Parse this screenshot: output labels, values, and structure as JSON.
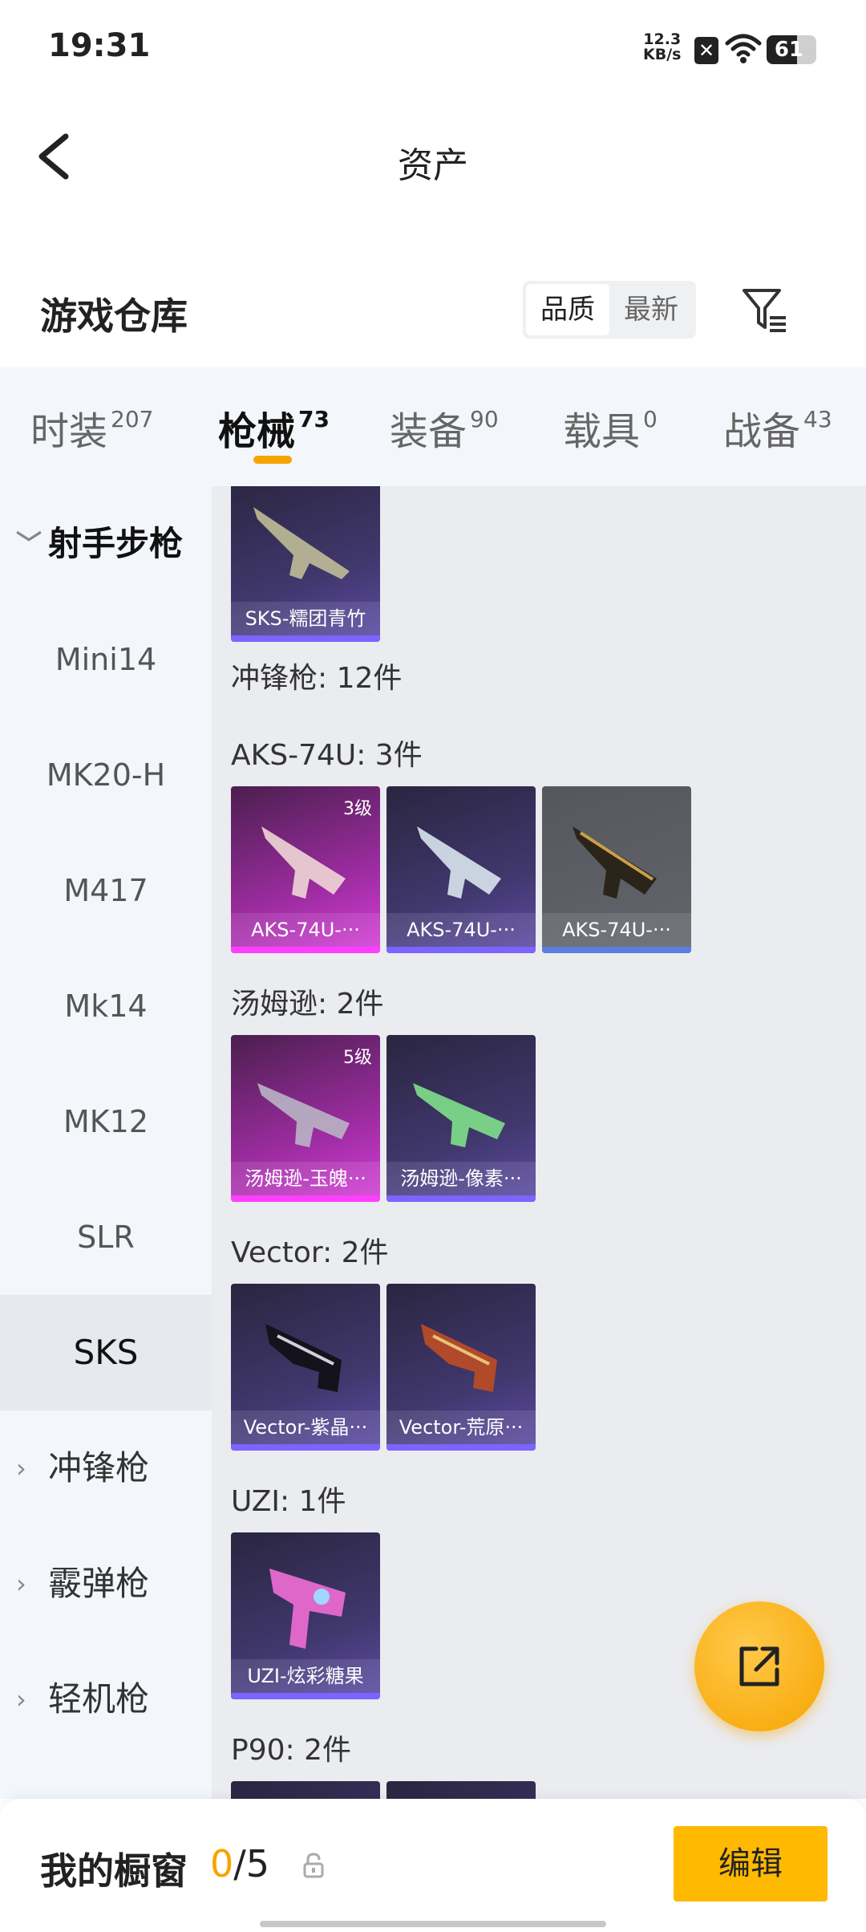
{
  "status_bar": {
    "time": "19:31",
    "net_speed": "12.3",
    "net_unit": "KB/s",
    "battery": "61"
  },
  "header": {
    "title": "资产"
  },
  "warehouse": {
    "title": "游戏仓库",
    "sort_options": [
      "品质",
      "最新"
    ],
    "active_sort": "品质"
  },
  "tabs": [
    {
      "label": "时装",
      "count": "207"
    },
    {
      "label": "枪械",
      "count": "73"
    },
    {
      "label": "装备",
      "count": "90"
    },
    {
      "label": "载具",
      "count": "0"
    },
    {
      "label": "战备",
      "count": "43"
    }
  ],
  "sidebar": {
    "group_open": "射手步枪",
    "items": [
      "Mini14",
      "MK20-H",
      "M417",
      "Mk14",
      "MK12",
      "SLR",
      "SKS"
    ],
    "active_item": "SKS",
    "collapsed_groups": [
      "冲锋枪",
      "霰弹枪",
      "轻机枪"
    ]
  },
  "content": {
    "top_card": {
      "name": "SKS-糯团青竹",
      "rarity": "purple"
    },
    "category_heading": "冲锋枪: 12件",
    "sections": [
      {
        "title": "AKS-74U: 3件",
        "cards": [
          {
            "name": "AKS-74U-···",
            "rarity": "pink",
            "level": "3级"
          },
          {
            "name": "AKS-74U-···",
            "rarity": "purple"
          },
          {
            "name": "AKS-74U-···",
            "rarity": "grey"
          }
        ]
      },
      {
        "title": "汤姆逊: 2件",
        "cards": [
          {
            "name": "汤姆逊-玉魄···",
            "rarity": "pink",
            "level": "5级"
          },
          {
            "name": "汤姆逊-像素···",
            "rarity": "purple"
          }
        ]
      },
      {
        "title": "Vector: 2件",
        "cards": [
          {
            "name": "Vector-紫晶···",
            "rarity": "purple"
          },
          {
            "name": "Vector-荒原···",
            "rarity": "purple"
          }
        ]
      },
      {
        "title": "UZI: 1件",
        "cards": [
          {
            "name": "UZI-炫彩糖果",
            "rarity": "purple"
          }
        ]
      },
      {
        "title": "P90: 2件",
        "cards": [
          {
            "name": "",
            "rarity": "purple"
          },
          {
            "name": "",
            "rarity": "purple"
          }
        ]
      }
    ]
  },
  "bottom_bar": {
    "title": "我的橱窗",
    "current": "0",
    "separator": "/",
    "max": "5",
    "edit_label": "编辑"
  },
  "icons": {
    "back": "chevron-left-icon",
    "filter": "filter-icon",
    "share": "share-icon",
    "lock": "lock-icon"
  },
  "colors": {
    "accent": "#f6a400",
    "edit_button": "#ffb900",
    "rarity_purple": "#7b64ff",
    "rarity_pink": "#ff3fff"
  }
}
